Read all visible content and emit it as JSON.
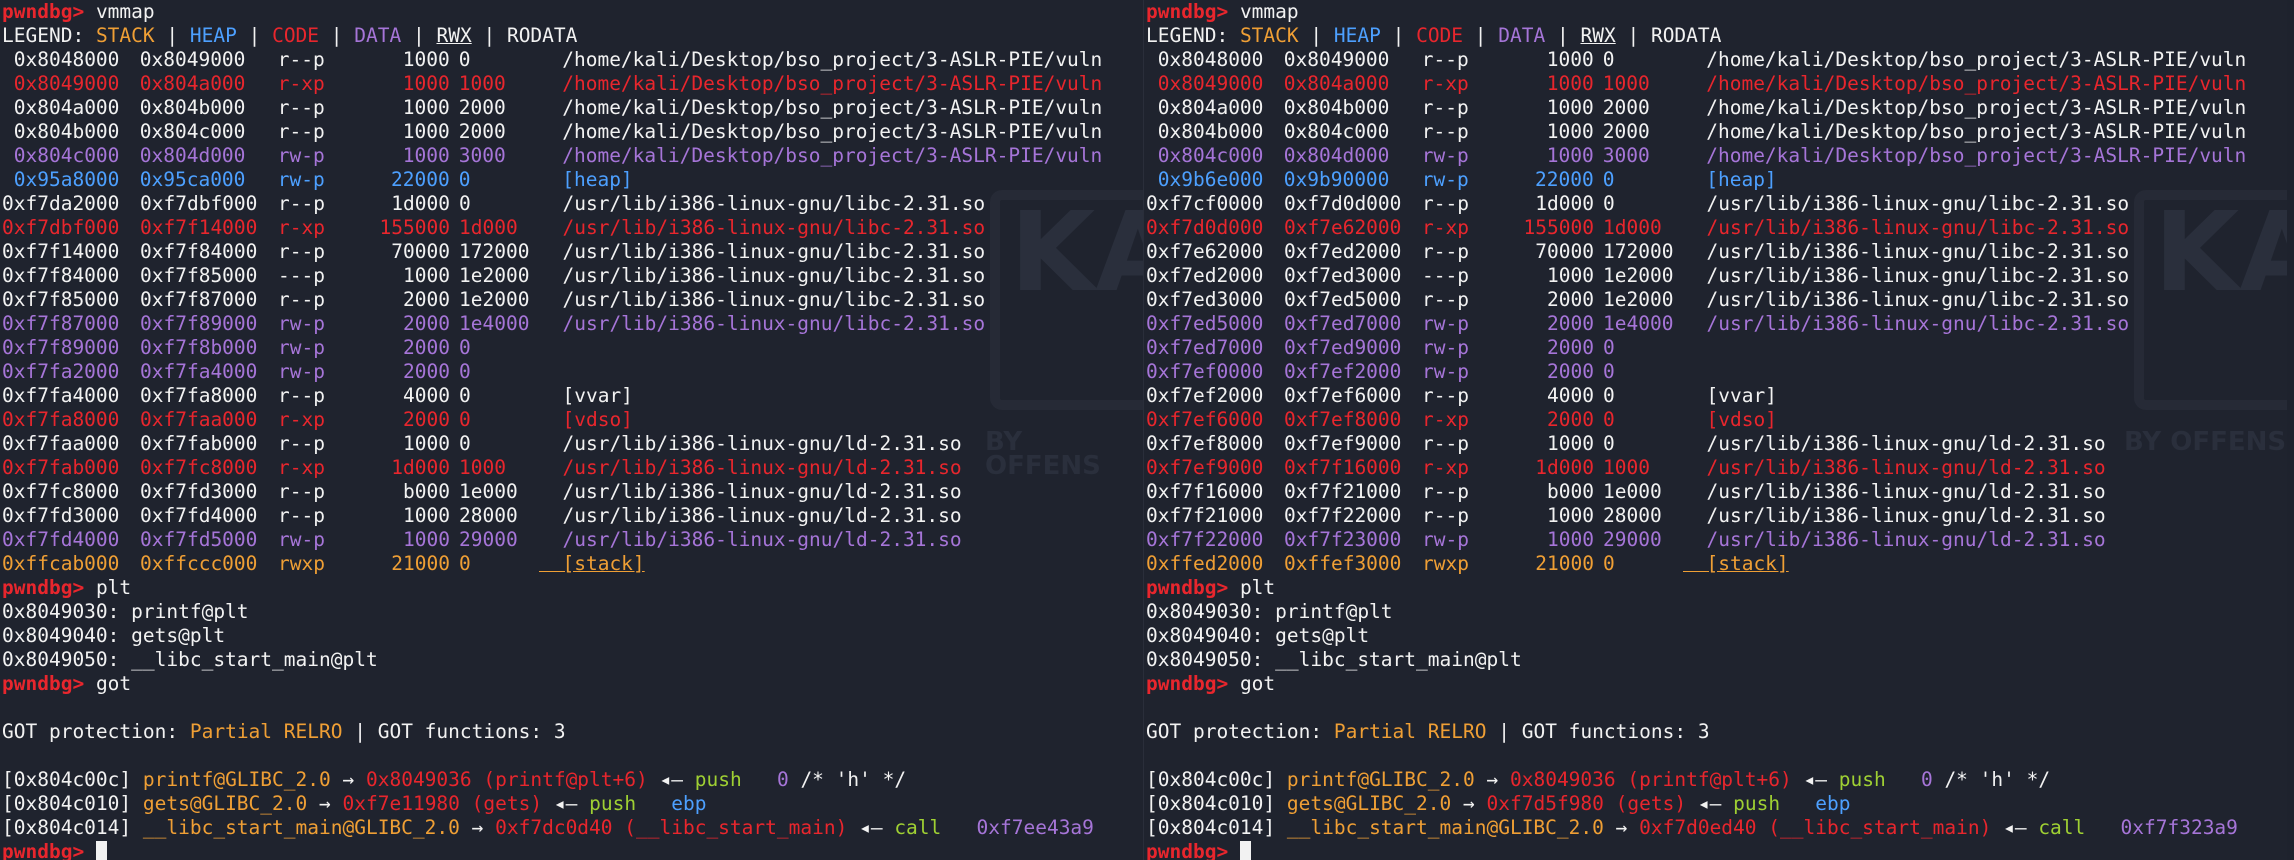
{
  "colors": {
    "background": "#1f232e",
    "prompt": "#e8262d",
    "stack": "#ef9f35",
    "heap": "#4da0ff",
    "code": "#e8262d",
    "data": "#a675d8",
    "rodata": "#f2f2f2",
    "green": "#9fd033"
  },
  "watermark": {
    "logo_text": "KA",
    "tagline": "BY OFFENS"
  },
  "panes": [
    {
      "id": "left",
      "prompt": "pwndbg>",
      "cmd_vmmap": "vmmap",
      "legend": {
        "label": "LEGEND:",
        "stack": "STACK",
        "heap": "HEAP",
        "code": "CODE",
        "data": "DATA",
        "rwx": "RWX",
        "rodata": "RODATA"
      },
      "maps": [
        {
          "start": "0x8048000",
          "end": "0x8049000",
          "perm": "r--p",
          "size": "1000",
          "off": "0",
          "path": "/home/kali/Desktop/bso_project/3-ASLR-PIE/vuln",
          "cls": "white",
          "indent": true
        },
        {
          "start": "0x8049000",
          "end": "0x804a000",
          "perm": "r-xp",
          "size": "1000",
          "off": "1000",
          "path": "/home/kali/Desktop/bso_project/3-ASLR-PIE/vuln",
          "cls": "red",
          "indent": true
        },
        {
          "start": "0x804a000",
          "end": "0x804b000",
          "perm": "r--p",
          "size": "1000",
          "off": "2000",
          "path": "/home/kali/Desktop/bso_project/3-ASLR-PIE/vuln",
          "cls": "white",
          "indent": true
        },
        {
          "start": "0x804b000",
          "end": "0x804c000",
          "perm": "r--p",
          "size": "1000",
          "off": "2000",
          "path": "/home/kali/Desktop/bso_project/3-ASLR-PIE/vuln",
          "cls": "white",
          "indent": true
        },
        {
          "start": "0x804c000",
          "end": "0x804d000",
          "perm": "rw-p",
          "size": "1000",
          "off": "3000",
          "path": "/home/kali/Desktop/bso_project/3-ASLR-PIE/vuln",
          "cls": "purple",
          "indent": true
        },
        {
          "start": "0x95a8000",
          "end": "0x95ca000",
          "perm": "rw-p",
          "size": "22000",
          "off": "0",
          "path": "[heap]",
          "cls": "blue",
          "indent": true
        },
        {
          "start": "0xf7da2000",
          "end": "0xf7dbf000",
          "perm": "r--p",
          "size": "1d000",
          "off": "0",
          "path": "/usr/lib/i386-linux-gnu/libc-2.31.so",
          "cls": "white"
        },
        {
          "start": "0xf7dbf000",
          "end": "0xf7f14000",
          "perm": "r-xp",
          "size": "155000",
          "off": "1d000",
          "path": "/usr/lib/i386-linux-gnu/libc-2.31.so",
          "cls": "red"
        },
        {
          "start": "0xf7f14000",
          "end": "0xf7f84000",
          "perm": "r--p",
          "size": "70000",
          "off": "172000",
          "path": "/usr/lib/i386-linux-gnu/libc-2.31.so",
          "cls": "white"
        },
        {
          "start": "0xf7f84000",
          "end": "0xf7f85000",
          "perm": "---p",
          "size": "1000",
          "off": "1e2000",
          "path": "/usr/lib/i386-linux-gnu/libc-2.31.so",
          "cls": "white"
        },
        {
          "start": "0xf7f85000",
          "end": "0xf7f87000",
          "perm": "r--p",
          "size": "2000",
          "off": "1e2000",
          "path": "/usr/lib/i386-linux-gnu/libc-2.31.so",
          "cls": "white"
        },
        {
          "start": "0xf7f87000",
          "end": "0xf7f89000",
          "perm": "rw-p",
          "size": "2000",
          "off": "1e4000",
          "path": "/usr/lib/i386-linux-gnu/libc-2.31.so",
          "cls": "purple"
        },
        {
          "start": "0xf7f89000",
          "end": "0xf7f8b000",
          "perm": "rw-p",
          "size": "2000",
          "off": "0",
          "path": "",
          "cls": "purple"
        },
        {
          "start": "0xf7fa2000",
          "end": "0xf7fa4000",
          "perm": "rw-p",
          "size": "2000",
          "off": "0",
          "path": "",
          "cls": "purple"
        },
        {
          "start": "0xf7fa4000",
          "end": "0xf7fa8000",
          "perm": "r--p",
          "size": "4000",
          "off": "0",
          "path": "[vvar]",
          "cls": "white"
        },
        {
          "start": "0xf7fa8000",
          "end": "0xf7faa000",
          "perm": "r-xp",
          "size": "2000",
          "off": "0",
          "path": "[vdso]",
          "cls": "red"
        },
        {
          "start": "0xf7faa000",
          "end": "0xf7fab000",
          "perm": "r--p",
          "size": "1000",
          "off": "0",
          "path": "/usr/lib/i386-linux-gnu/ld-2.31.so",
          "cls": "white"
        },
        {
          "start": "0xf7fab000",
          "end": "0xf7fc8000",
          "perm": "r-xp",
          "size": "1d000",
          "off": "1000",
          "path": "/usr/lib/i386-linux-gnu/ld-2.31.so",
          "cls": "red"
        },
        {
          "start": "0xf7fc8000",
          "end": "0xf7fd3000",
          "perm": "r--p",
          "size": "b000",
          "off": "1e000",
          "path": "/usr/lib/i386-linux-gnu/ld-2.31.so",
          "cls": "white"
        },
        {
          "start": "0xf7fd3000",
          "end": "0xf7fd4000",
          "perm": "r--p",
          "size": "1000",
          "off": "28000",
          "path": "/usr/lib/i386-linux-gnu/ld-2.31.so",
          "cls": "white"
        },
        {
          "start": "0xf7fd4000",
          "end": "0xf7fd5000",
          "perm": "rw-p",
          "size": "1000",
          "off": "29000",
          "path": "/usr/lib/i386-linux-gnu/ld-2.31.so",
          "cls": "purple"
        },
        {
          "start": "0xffcab000",
          "end": "0xffccc000",
          "perm": "rwxp",
          "size": "21000",
          "off": "0",
          "path": "[stack]",
          "cls": "orange",
          "underline": true
        }
      ],
      "cmd_plt": "plt",
      "plt": [
        "0x8049030: printf@plt",
        "0x8049040: gets@plt",
        "0x8049050: __libc_start_main@plt"
      ],
      "cmd_got": "got",
      "got_prot_label": "GOT protection:",
      "got_prot_value": "Partial RELRO",
      "got_funcs": "GOT functions: 3",
      "got": [
        {
          "addr": "[0x804c00c]",
          "sym": "printf@GLIBC_2.0",
          "arrow": "→",
          "target": "0x8049036 (printf@plt+6)",
          "larrow": "◂—",
          "instr": "push",
          "arg": "0",
          "comment": "/* 'h' */",
          "argcls": "purple"
        },
        {
          "addr": "[0x804c010]",
          "sym": "gets@GLIBC_2.0",
          "arrow": "→",
          "target": "0xf7e11980 (gets)",
          "larrow": "◂—",
          "instr": "push",
          "arg": "ebp",
          "comment": "",
          "argcls": "blue"
        },
        {
          "addr": "[0x804c014]",
          "sym": "__libc_start_main@GLIBC_2.0",
          "arrow": "→",
          "target": "0xf7dc0d40 (__libc_start_main)",
          "larrow": "◂—",
          "instr": "call",
          "arg": "0xf7ee43a9",
          "comment": "",
          "argcls": "purple"
        }
      ]
    },
    {
      "id": "right",
      "prompt": "pwndbg>",
      "cmd_vmmap": "vmmap",
      "legend": {
        "label": "LEGEND:",
        "stack": "STACK",
        "heap": "HEAP",
        "code": "CODE",
        "data": "DATA",
        "rwx": "RWX",
        "rodata": "RODATA"
      },
      "maps": [
        {
          "start": "0x8048000",
          "end": "0x8049000",
          "perm": "r--p",
          "size": "1000",
          "off": "0",
          "path": "/home/kali/Desktop/bso_project/3-ASLR-PIE/vuln",
          "cls": "white",
          "indent": true
        },
        {
          "start": "0x8049000",
          "end": "0x804a000",
          "perm": "r-xp",
          "size": "1000",
          "off": "1000",
          "path": "/home/kali/Desktop/bso_project/3-ASLR-PIE/vuln",
          "cls": "red",
          "indent": true
        },
        {
          "start": "0x804a000",
          "end": "0x804b000",
          "perm": "r--p",
          "size": "1000",
          "off": "2000",
          "path": "/home/kali/Desktop/bso_project/3-ASLR-PIE/vuln",
          "cls": "white",
          "indent": true
        },
        {
          "start": "0x804b000",
          "end": "0x804c000",
          "perm": "r--p",
          "size": "1000",
          "off": "2000",
          "path": "/home/kali/Desktop/bso_project/3-ASLR-PIE/vuln",
          "cls": "white",
          "indent": true
        },
        {
          "start": "0x804c000",
          "end": "0x804d000",
          "perm": "rw-p",
          "size": "1000",
          "off": "3000",
          "path": "/home/kali/Desktop/bso_project/3-ASLR-PIE/vuln",
          "cls": "purple",
          "indent": true
        },
        {
          "start": "0x9b6e000",
          "end": "0x9b90000",
          "perm": "rw-p",
          "size": "22000",
          "off": "0",
          "path": "[heap]",
          "cls": "blue",
          "indent": true
        },
        {
          "start": "0xf7cf0000",
          "end": "0xf7d0d000",
          "perm": "r--p",
          "size": "1d000",
          "off": "0",
          "path": "/usr/lib/i386-linux-gnu/libc-2.31.so",
          "cls": "white"
        },
        {
          "start": "0xf7d0d000",
          "end": "0xf7e62000",
          "perm": "r-xp",
          "size": "155000",
          "off": "1d000",
          "path": "/usr/lib/i386-linux-gnu/libc-2.31.so",
          "cls": "red"
        },
        {
          "start": "0xf7e62000",
          "end": "0xf7ed2000",
          "perm": "r--p",
          "size": "70000",
          "off": "172000",
          "path": "/usr/lib/i386-linux-gnu/libc-2.31.so",
          "cls": "white"
        },
        {
          "start": "0xf7ed2000",
          "end": "0xf7ed3000",
          "perm": "---p",
          "size": "1000",
          "off": "1e2000",
          "path": "/usr/lib/i386-linux-gnu/libc-2.31.so",
          "cls": "white"
        },
        {
          "start": "0xf7ed3000",
          "end": "0xf7ed5000",
          "perm": "r--p",
          "size": "2000",
          "off": "1e2000",
          "path": "/usr/lib/i386-linux-gnu/libc-2.31.so",
          "cls": "white"
        },
        {
          "start": "0xf7ed5000",
          "end": "0xf7ed7000",
          "perm": "rw-p",
          "size": "2000",
          "off": "1e4000",
          "path": "/usr/lib/i386-linux-gnu/libc-2.31.so",
          "cls": "purple"
        },
        {
          "start": "0xf7ed7000",
          "end": "0xf7ed9000",
          "perm": "rw-p",
          "size": "2000",
          "off": "0",
          "path": "",
          "cls": "purple"
        },
        {
          "start": "0xf7ef0000",
          "end": "0xf7ef2000",
          "perm": "rw-p",
          "size": "2000",
          "off": "0",
          "path": "",
          "cls": "purple"
        },
        {
          "start": "0xf7ef2000",
          "end": "0xf7ef6000",
          "perm": "r--p",
          "size": "4000",
          "off": "0",
          "path": "[vvar]",
          "cls": "white"
        },
        {
          "start": "0xf7ef6000",
          "end": "0xf7ef8000",
          "perm": "r-xp",
          "size": "2000",
          "off": "0",
          "path": "[vdso]",
          "cls": "red"
        },
        {
          "start": "0xf7ef8000",
          "end": "0xf7ef9000",
          "perm": "r--p",
          "size": "1000",
          "off": "0",
          "path": "/usr/lib/i386-linux-gnu/ld-2.31.so",
          "cls": "white"
        },
        {
          "start": "0xf7ef9000",
          "end": "0xf7f16000",
          "perm": "r-xp",
          "size": "1d000",
          "off": "1000",
          "path": "/usr/lib/i386-linux-gnu/ld-2.31.so",
          "cls": "red"
        },
        {
          "start": "0xf7f16000",
          "end": "0xf7f21000",
          "perm": "r--p",
          "size": "b000",
          "off": "1e000",
          "path": "/usr/lib/i386-linux-gnu/ld-2.31.so",
          "cls": "white"
        },
        {
          "start": "0xf7f21000",
          "end": "0xf7f22000",
          "perm": "r--p",
          "size": "1000",
          "off": "28000",
          "path": "/usr/lib/i386-linux-gnu/ld-2.31.so",
          "cls": "white"
        },
        {
          "start": "0xf7f22000",
          "end": "0xf7f23000",
          "perm": "rw-p",
          "size": "1000",
          "off": "29000",
          "path": "/usr/lib/i386-linux-gnu/ld-2.31.so",
          "cls": "purple"
        },
        {
          "start": "0xffed2000",
          "end": "0xffef3000",
          "perm": "rwxp",
          "size": "21000",
          "off": "0",
          "path": "[stack]",
          "cls": "orange",
          "underline": true
        }
      ],
      "cmd_plt": "plt",
      "plt": [
        "0x8049030: printf@plt",
        "0x8049040: gets@plt",
        "0x8049050: __libc_start_main@plt"
      ],
      "cmd_got": "got",
      "got_prot_label": "GOT protection:",
      "got_prot_value": "Partial RELRO",
      "got_funcs": "GOT functions: 3",
      "got": [
        {
          "addr": "[0x804c00c]",
          "sym": "printf@GLIBC_2.0",
          "arrow": "→",
          "target": "0x8049036 (printf@plt+6)",
          "larrow": "◂—",
          "instr": "push",
          "arg": "0",
          "comment": "/* 'h' */",
          "argcls": "purple"
        },
        {
          "addr": "[0x804c010]",
          "sym": "gets@GLIBC_2.0",
          "arrow": "→",
          "target": "0xf7d5f980 (gets)",
          "larrow": "◂—",
          "instr": "push",
          "arg": "ebp",
          "comment": "",
          "argcls": "blue"
        },
        {
          "addr": "[0x804c014]",
          "sym": "__libc_start_main@GLIBC_2.0",
          "arrow": "→",
          "target": "0xf7d0ed40 (__libc_start_main)",
          "larrow": "◂—",
          "instr": "call",
          "arg": "0xf7f323a9",
          "comment": "",
          "argcls": "purple"
        }
      ]
    }
  ]
}
